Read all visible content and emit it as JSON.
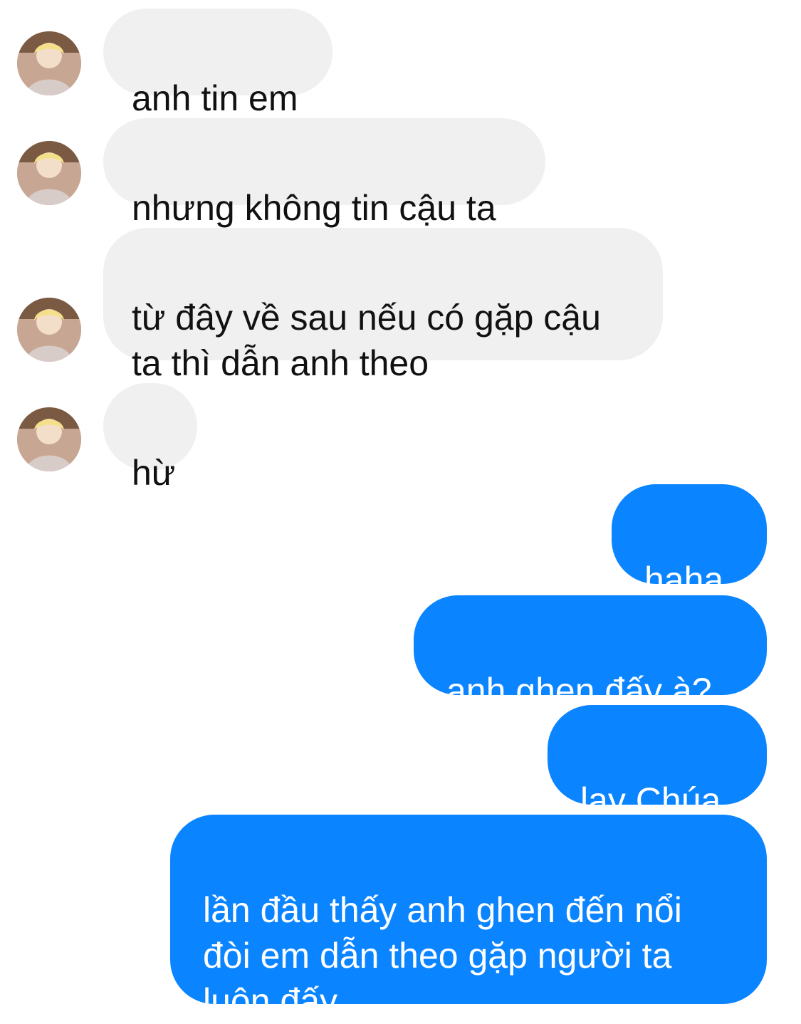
{
  "conversation": {
    "incoming": [
      {
        "text": "anh tin em"
      },
      {
        "text": "nhưng không tin cậu ta"
      },
      {
        "text": "từ đây về sau nếu có gặp cậu ta thì dẫn anh theo"
      },
      {
        "text": "hừ"
      }
    ],
    "outgoing": [
      {
        "text": "haha"
      },
      {
        "text": "anh ghen đấy à?"
      },
      {
        "text": "lạy Chúa"
      },
      {
        "text": "lần đầu thấy anh ghen đến nổi đòi em dẫn theo gặp người ta luôn đấy"
      }
    ]
  },
  "colors": {
    "incoming_bubble": "#f0f0f0",
    "outgoing_bubble": "#0a84ff",
    "incoming_text": "#111111",
    "outgoing_text": "#ffffff"
  },
  "icons": {
    "avatar": "contact-avatar-icon"
  }
}
